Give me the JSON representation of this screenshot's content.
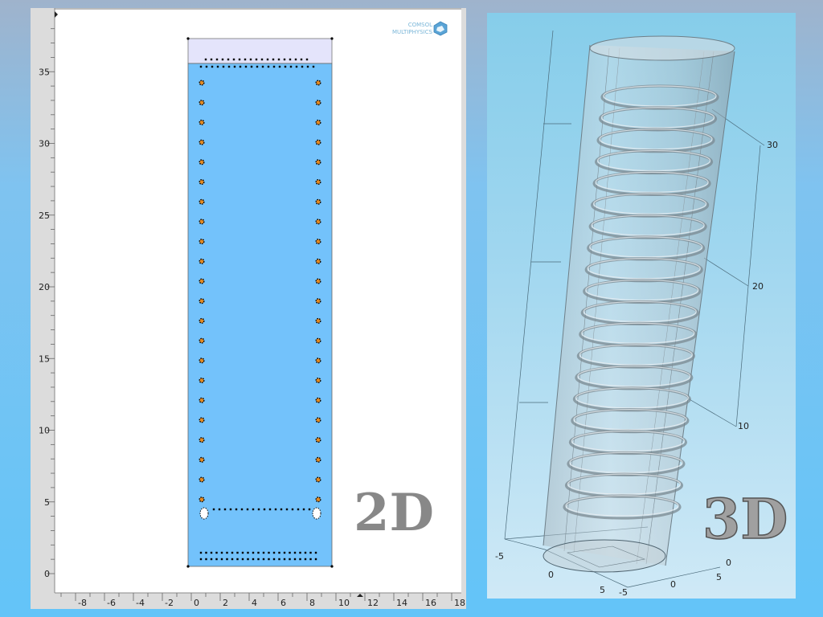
{
  "panel_2d": {
    "label": "2D",
    "logo": {
      "line1": "COMSOL",
      "line2": "MULTIPHYSICS"
    },
    "y_ticks": [
      "0",
      "5",
      "10",
      "15",
      "20",
      "25",
      "30",
      "35"
    ],
    "x_ticks": [
      "-8",
      "-6",
      "-4",
      "-2",
      "0",
      "2",
      "4",
      "6",
      "8",
      "10",
      "12",
      "14",
      "16",
      "18"
    ],
    "coil_turns": 22,
    "colors": {
      "domain": "#73c2fb",
      "top_layer": "#e4e4fb",
      "coil": "#e48a22"
    }
  },
  "panel_3d": {
    "label": "3D",
    "z_ticks": [
      "10",
      "20",
      "30"
    ],
    "base_ticks": [
      "-5",
      "0",
      "5",
      "-5",
      "0",
      "5",
      "0"
    ],
    "ring_count": 20,
    "colors": {
      "background": "#9fd6ef",
      "cylinder": "#c8d2d8"
    }
  }
}
